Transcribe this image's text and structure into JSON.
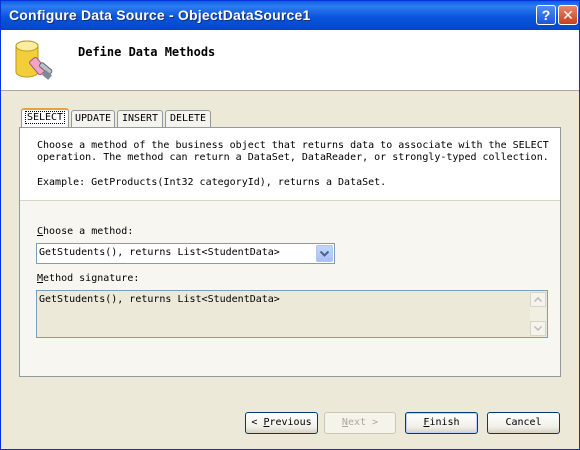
{
  "window": {
    "title": "Configure Data Source - ObjectDataSource1",
    "help_label": "?",
    "close_label": "✕"
  },
  "header": {
    "title": "Define Data Methods",
    "icon": "database-icon"
  },
  "tabs": [
    {
      "label": "SELECT",
      "active": true
    },
    {
      "label": "UPDATE",
      "active": false
    },
    {
      "label": "INSERT",
      "active": false
    },
    {
      "label": "DELETE",
      "active": false
    }
  ],
  "description": {
    "text": "Choose a method of the business object that returns data to associate with the SELECT operation. The method can return a DataSet, DataReader, or strongly-typed collection.",
    "example": "Example: GetProducts(Int32 categoryId), returns a DataSet."
  },
  "method": {
    "label_mnemonic": "C",
    "label_rest": "hoose a method:",
    "selected": "GetStudents(), returns List<StudentData>"
  },
  "signature": {
    "label_mnemonic": "M",
    "label_rest": "ethod signature:",
    "value": "GetStudents(), returns List<StudentData>"
  },
  "buttons": {
    "previous_arrow": "<",
    "previous_mnemonic": "P",
    "previous_rest": "revious",
    "next_mnemonic": "N",
    "next_rest": "ext",
    "next_arrow": ">",
    "finish_mnemonic": "F",
    "finish_rest": "inish",
    "cancel": "Cancel"
  },
  "colors": {
    "titlebar": "#0a55dd",
    "dialog_bg": "#ece9d8",
    "active_tab_accent": "#e8a33d"
  }
}
